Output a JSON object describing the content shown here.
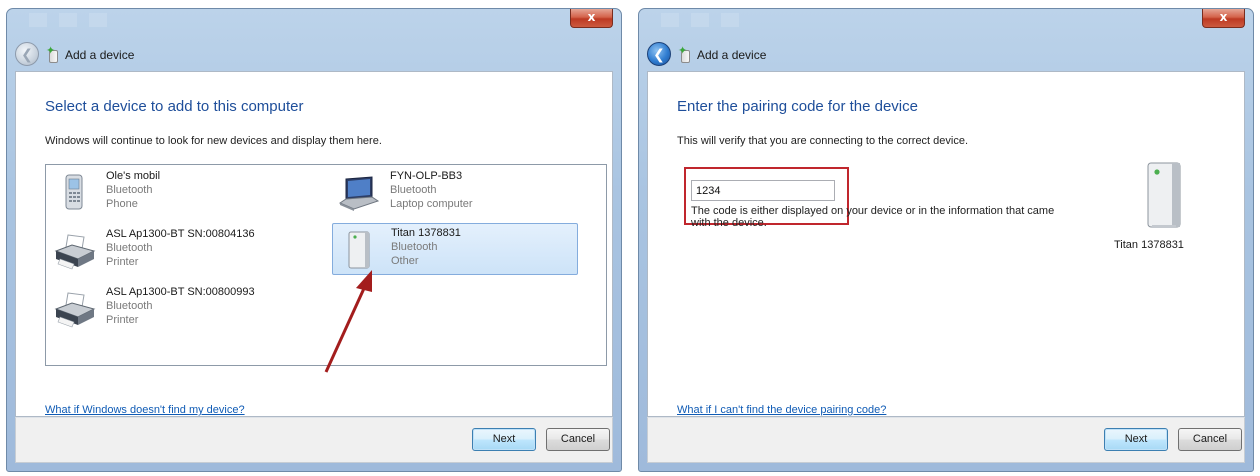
{
  "left_window": {
    "close_label": "x",
    "nav_title": "Add a device",
    "heading": "Select a device to add to this computer",
    "subtext": "Windows will continue to look for new devices and display them here.",
    "devices": [
      {
        "name": "Ole's mobil",
        "line2": "Bluetooth",
        "line3": "Phone",
        "icon": "phone-icon"
      },
      {
        "name": "FYN-OLP-BB3",
        "line2": "Bluetooth",
        "line3": "Laptop computer",
        "icon": "laptop-icon"
      },
      {
        "name": "ASL Ap1300-BT SN:00804136",
        "line2": "Bluetooth",
        "line3": "Printer",
        "icon": "printer-icon"
      },
      {
        "name": "Titan 1378831",
        "line2": "Bluetooth",
        "line3": "Other",
        "icon": "device-tower-icon",
        "selected": true
      },
      {
        "name": "ASL Ap1300-BT SN:00800993",
        "line2": "Bluetooth",
        "line3": "Printer",
        "icon": "printer-icon"
      }
    ],
    "help_link": "What if Windows doesn't find my device?",
    "next_label": "Next",
    "cancel_label": "Cancel"
  },
  "right_window": {
    "close_label": "x",
    "nav_title": "Add a device",
    "heading": "Enter the pairing code for the device",
    "subtext": "This will verify that you are connecting to the correct device.",
    "code_value": "1234",
    "code_help": "The code is either displayed on your device or in the information that came with the device.",
    "device_name": "Titan 1378831",
    "help_link": "What if I can't find the device pairing code?",
    "next_label": "Next",
    "cancel_label": "Cancel"
  },
  "colors": {
    "heading": "#1e4e9a",
    "link": "#0f5bb5",
    "annotation": "#c0262d",
    "arrow": "#a31d1d",
    "selection": "#cde3f8"
  }
}
